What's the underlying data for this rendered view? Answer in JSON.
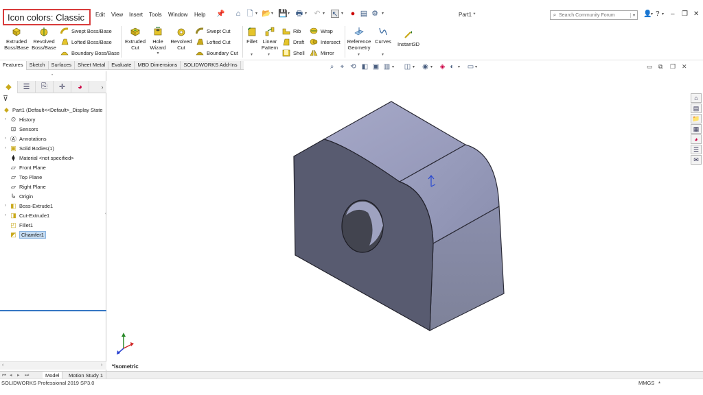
{
  "annotation": {
    "text": "Icon colors: Classic"
  },
  "menu": {
    "items": [
      "Edit",
      "View",
      "Insert",
      "Tools",
      "Window",
      "Help"
    ]
  },
  "document": {
    "title": "Part1 *"
  },
  "search": {
    "placeholder": "Search Community Forum"
  },
  "ribbon": {
    "extruded_boss": "Extruded Boss/Base",
    "revolved_boss": "Revolved Boss/Base",
    "swept_boss": "Swept Boss/Base",
    "lofted_boss": "Lofted Boss/Base",
    "boundary_boss": "Boundary Boss/Base",
    "extruded_cut": "Extruded Cut",
    "hole_wizard": "Hole Wizard",
    "revolved_cut": "Revolved Cut",
    "swept_cut": "Swept Cut",
    "lofted_cut": "Lofted Cut",
    "boundary_cut": "Boundary Cut",
    "fillet": "Fillet",
    "linear_pattern": "Linear Pattern",
    "rib": "Rib",
    "draft": "Draft",
    "shell": "Shell",
    "wrap": "Wrap",
    "intersect": "Intersect",
    "mirror": "Mirror",
    "reference_geometry": "Reference Geometry",
    "curves": "Curves",
    "instant3d": "Instant3D"
  },
  "cm_tabs": [
    "Features",
    "Sketch",
    "Surfaces",
    "Sheet Metal",
    "Evaluate",
    "MBD Dimensions",
    "SOLIDWORKS Add-Ins"
  ],
  "tree": [
    {
      "label": "Part1  (Default<<Default>_Display State"
    },
    {
      "label": "History"
    },
    {
      "label": "Sensors"
    },
    {
      "label": "Annotations"
    },
    {
      "label": "Solid Bodies(1)"
    },
    {
      "label": "Material <not specified>"
    },
    {
      "label": "Front Plane"
    },
    {
      "label": "Top Plane"
    },
    {
      "label": "Right Plane"
    },
    {
      "label": "Origin"
    },
    {
      "label": "Boss-Extrude1"
    },
    {
      "label": "Cut-Extrude1"
    },
    {
      "label": "Fillet1"
    },
    {
      "label": "Chamfer1"
    }
  ],
  "bottom_tabs": {
    "model": "Model",
    "motion": "Motion Study 1"
  },
  "status": {
    "app": "SOLIDWORKS Professional 2019 SP3.0",
    "units": "MMGS"
  },
  "view": {
    "orientation": "*Isometric"
  },
  "colors": {
    "annotation_border": "#d83b3b",
    "selection": "#c5dcf2",
    "part_face_top": "#9ea2c2",
    "part_face_front": "#585b70"
  }
}
